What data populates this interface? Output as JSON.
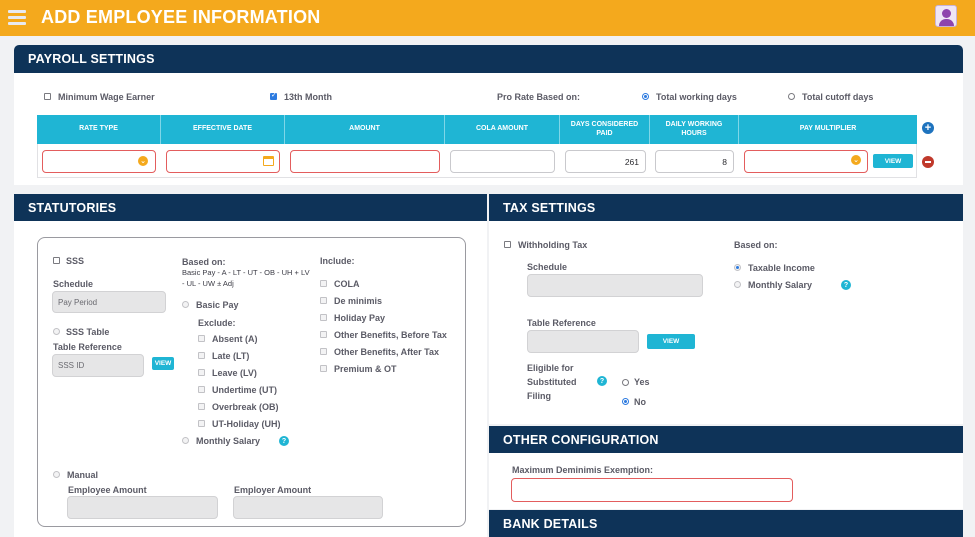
{
  "app": {
    "title": "ADD EMPLOYEE INFORMATION"
  },
  "colors": {
    "accent": "#f4a91d",
    "header": "#0e3358",
    "teal": "#1fb5d4",
    "error": "#e35d5d"
  },
  "payroll": {
    "title": "PAYROLL SETTINGS",
    "min_wage": "Minimum Wage Earner",
    "thirteenth": "13th Month",
    "prorate_label": "Pro Rate Based on:",
    "opt_working": "Total working days",
    "opt_cutoff": "Total cutoff days",
    "columns": [
      "RATE TYPE",
      "EFFECTIVE DATE",
      "AMOUNT",
      "COLA AMOUNT",
      "DAYS CONSIDERED PAID",
      "DAILY WORKING HOURS",
      "PAY MULTIPLIER"
    ],
    "row": {
      "days_paid": "261",
      "daily_hours": "8"
    },
    "view": "VIEW"
  },
  "statutories": {
    "title": "STATUTORIES",
    "sss": "SSS",
    "schedule": "Schedule",
    "schedule_val": "Pay Period",
    "sss_table": "SSS Table",
    "table_ref": "Table Reference",
    "sss_id": "SSS ID",
    "view": "VIEW",
    "based_on": "Based on:",
    "formula": "Basic Pay - A - LT - UT - OB - UH + LV - UL - UW ± Adj",
    "basic_pay": "Basic Pay",
    "exclude": "Exclude:",
    "excludes": [
      "Absent (A)",
      "Late (LT)",
      "Leave (LV)",
      "Undertime (UT)",
      "Overbreak (OB)",
      "UT-Holiday (UH)"
    ],
    "monthly_salary": "Monthly Salary",
    "include": "Include:",
    "includes": [
      "COLA",
      "De minimis",
      "Holiday Pay",
      "Other Benefits, Before Tax",
      "Other Benefits, After Tax",
      "Premium & OT"
    ],
    "manual": "Manual",
    "employee_amount": "Employee Amount",
    "employer_amount": "Employer Amount"
  },
  "tax": {
    "title": "TAX SETTINGS",
    "withholding": "Withholding Tax",
    "schedule": "Schedule",
    "table_ref": "Table Reference",
    "view": "VIEW",
    "eligible": "Eligible for",
    "substituted": "Substituted",
    "filing": "Filing",
    "yes": "Yes",
    "no": "No",
    "based_on": "Based on:",
    "taxable": "Taxable Income",
    "monthly": "Monthly Salary"
  },
  "other": {
    "title": "OTHER CONFIGURATION",
    "max_deminimis": "Maximum Deminimis Exemption:"
  },
  "bank": {
    "title": "BANK DETAILS"
  }
}
